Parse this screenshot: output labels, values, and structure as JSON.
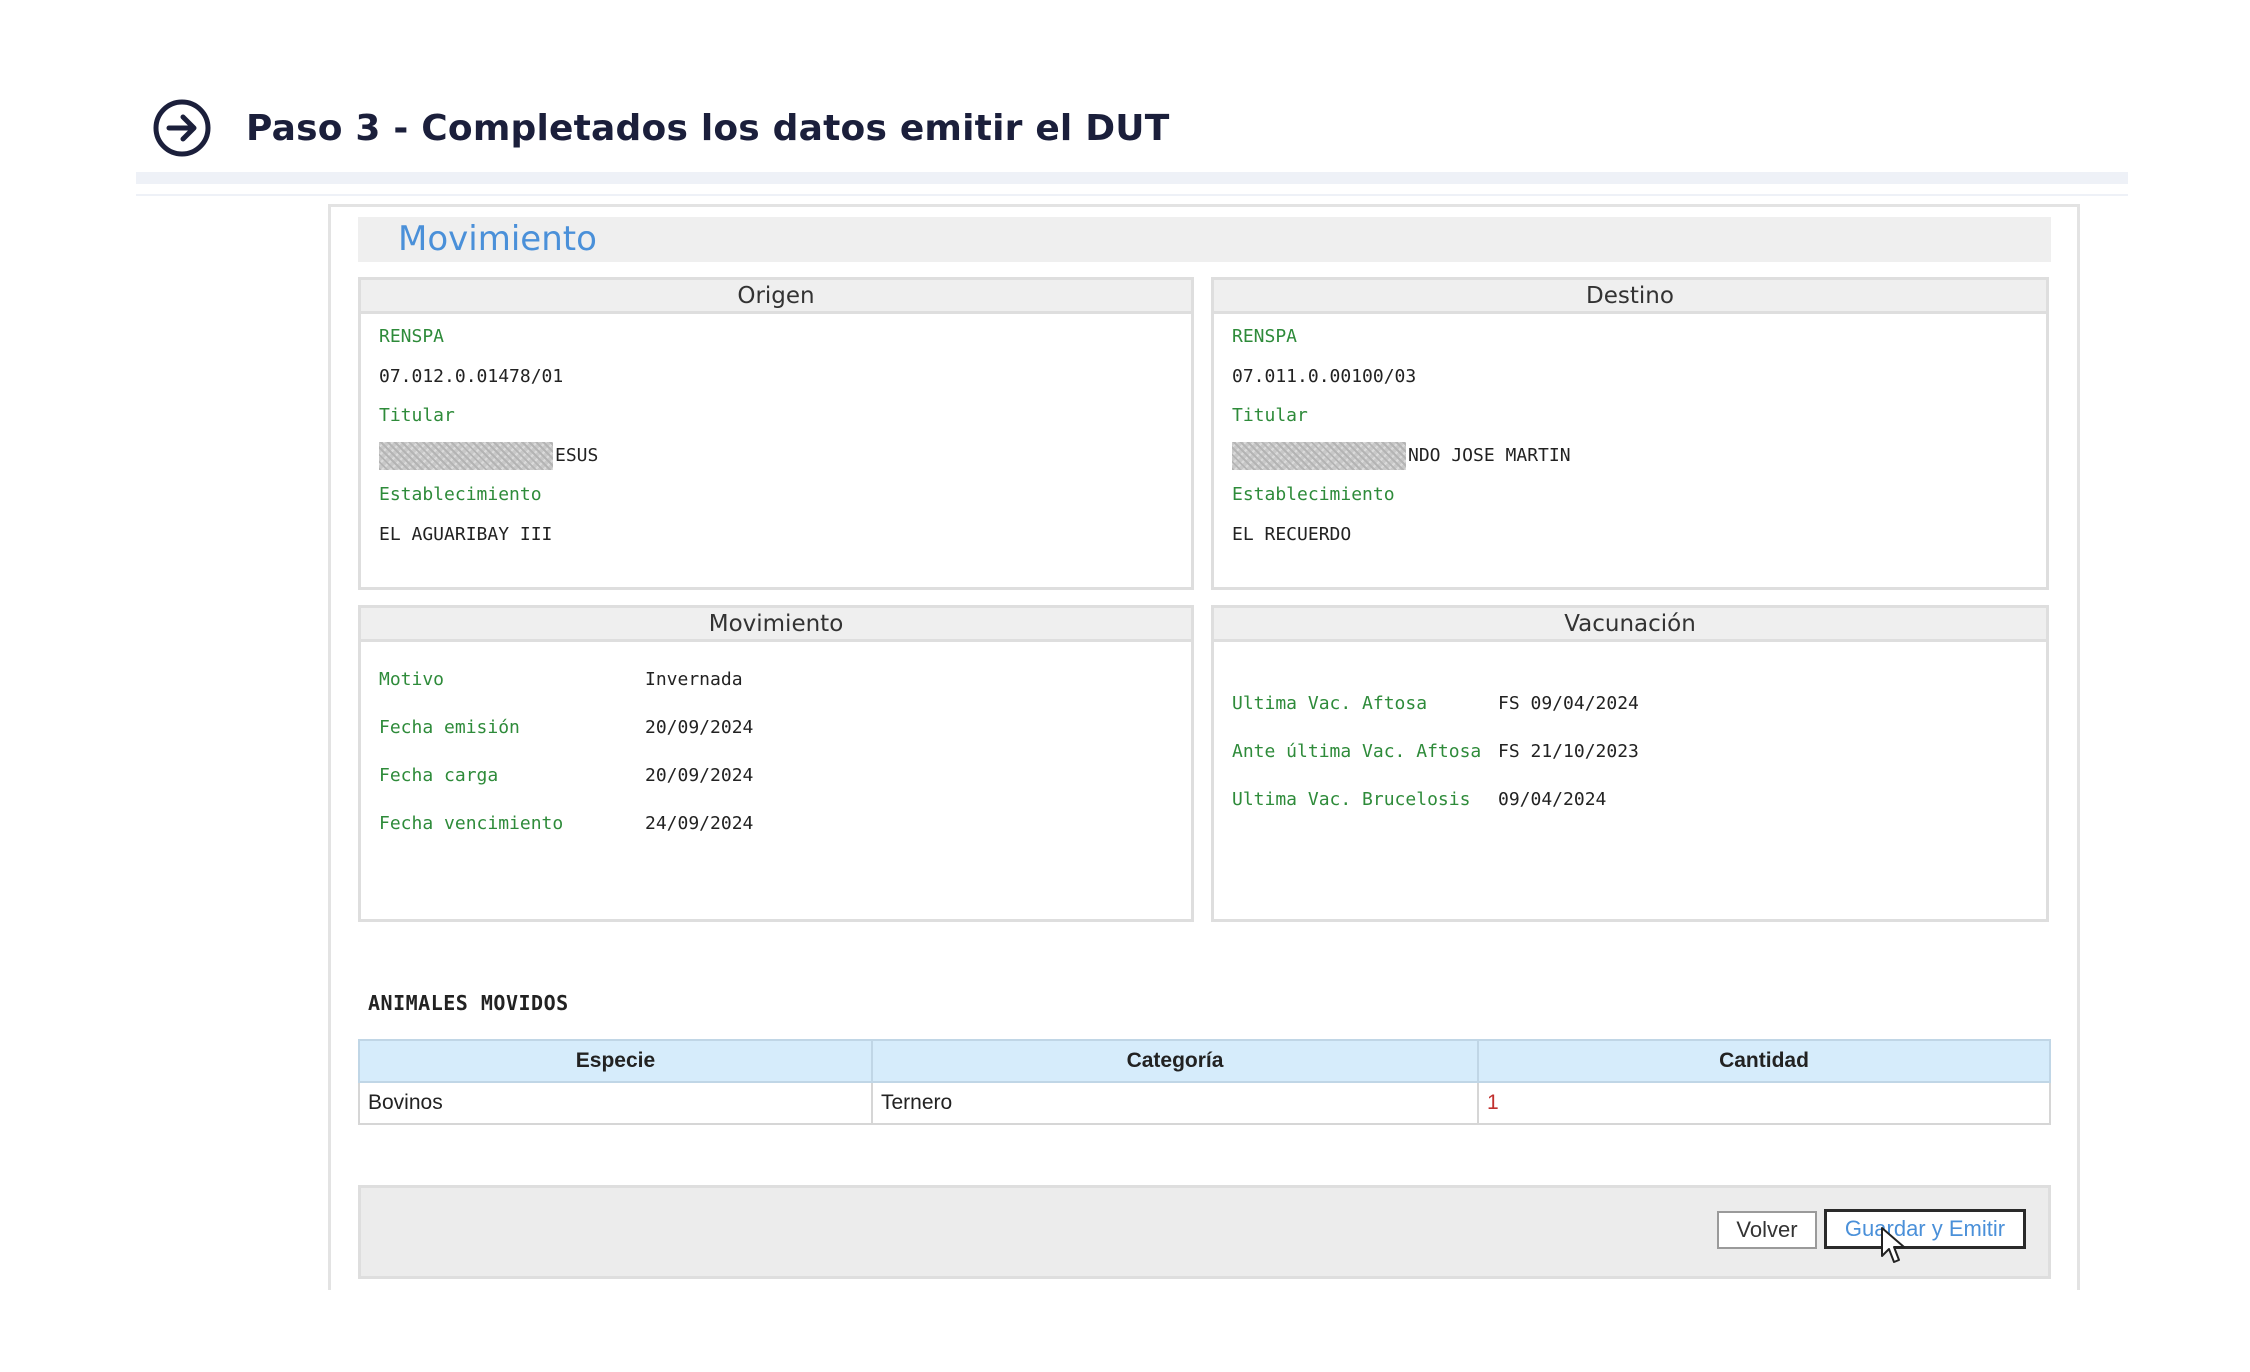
{
  "header": {
    "icon": "arrow-right-circle-icon",
    "title": "Paso 3 - Completados los datos emitir el DUT"
  },
  "section": {
    "title": "Movimiento"
  },
  "origen": {
    "heading": "Origen",
    "renspa_label": "RENSPA",
    "renspa": "07.012.0.01478/01",
    "titular_label": "Titular",
    "titular": "ESUS",
    "establecimiento_label": "Establecimiento",
    "establecimiento": "EL AGUARIBAY III"
  },
  "destino": {
    "heading": "Destino",
    "renspa_label": "RENSPA",
    "renspa": "07.011.0.00100/03",
    "titular_label": "Titular",
    "titular": "NDO JOSE MARTIN",
    "establecimiento_label": "Establecimiento",
    "establecimiento": "EL RECUERDO"
  },
  "movimiento": {
    "heading": "Movimiento",
    "rows": [
      {
        "label": "Motivo",
        "value": "Invernada"
      },
      {
        "label": "Fecha emisión",
        "value": "20/09/2024"
      },
      {
        "label": "Fecha carga",
        "value": "20/09/2024"
      },
      {
        "label": "Fecha vencimiento",
        "value": "24/09/2024"
      }
    ]
  },
  "vacunacion": {
    "heading": "Vacunación",
    "rows": [
      {
        "label": "Ultima Vac. Aftosa",
        "value": "FS 09/04/2024"
      },
      {
        "label": "Ante última Vac. Aftosa",
        "value": "FS 21/10/2023"
      },
      {
        "label": "Ultima Vac. Brucelosis",
        "value": "09/04/2024"
      }
    ]
  },
  "animales": {
    "title": "ANIMALES MOVIDOS",
    "columns": [
      "Especie",
      "Categoría",
      "Cantidad"
    ],
    "rows": [
      [
        "Bovinos",
        "Ternero",
        "1"
      ]
    ]
  },
  "actions": {
    "volver": "Volver",
    "emitir": "Guardar y Emitir"
  }
}
